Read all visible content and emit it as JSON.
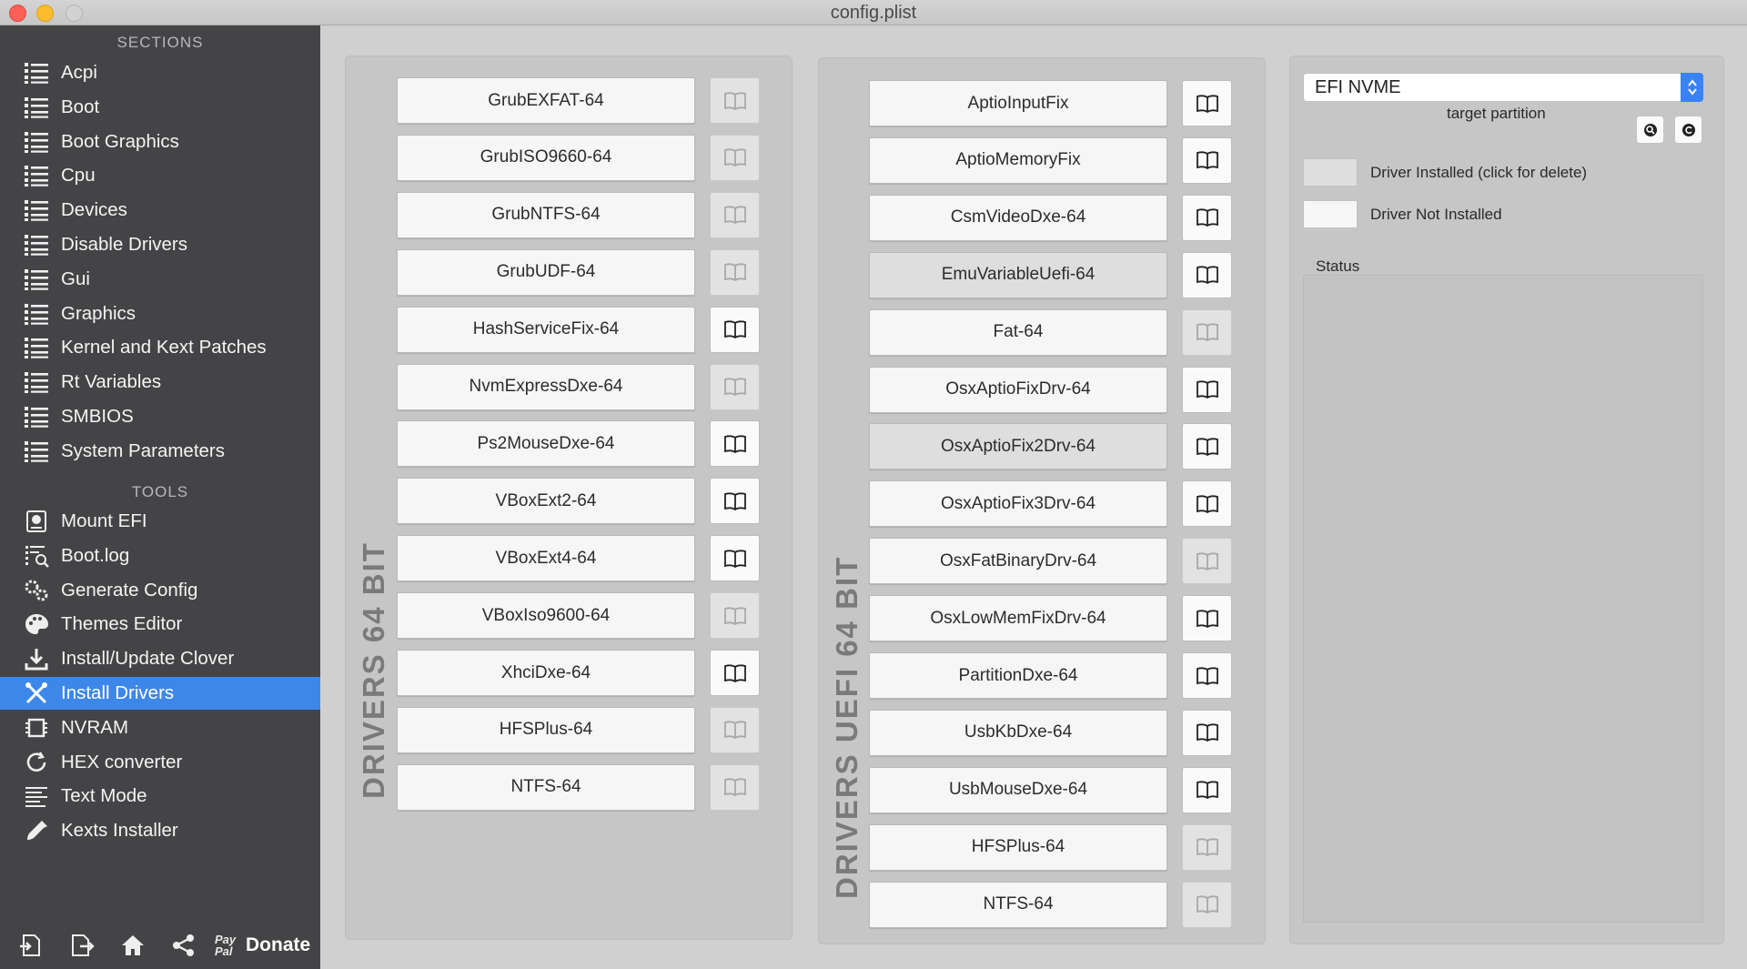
{
  "window": {
    "title": "config.plist"
  },
  "sidebar": {
    "sections_header": "SECTIONS",
    "sections": [
      {
        "label": "Acpi",
        "icon": "list-icon"
      },
      {
        "label": "Boot",
        "icon": "list-icon"
      },
      {
        "label": "Boot Graphics",
        "icon": "list-icon"
      },
      {
        "label": "Cpu",
        "icon": "list-icon"
      },
      {
        "label": "Devices",
        "icon": "list-icon"
      },
      {
        "label": "Disable Drivers",
        "icon": "list-icon"
      },
      {
        "label": "Gui",
        "icon": "list-icon"
      },
      {
        "label": "Graphics",
        "icon": "list-icon"
      },
      {
        "label": "Kernel and Kext Patches",
        "icon": "list-icon"
      },
      {
        "label": "Rt Variables",
        "icon": "list-icon"
      },
      {
        "label": "SMBIOS",
        "icon": "list-icon"
      },
      {
        "label": "System Parameters",
        "icon": "list-icon"
      }
    ],
    "tools_header": "TOOLS",
    "tools": [
      {
        "label": "Mount EFI",
        "icon": "disk-icon"
      },
      {
        "label": "Boot.log",
        "icon": "log-icon"
      },
      {
        "label": "Generate Config",
        "icon": "gears-icon"
      },
      {
        "label": "Themes Editor",
        "icon": "palette-icon"
      },
      {
        "label": "Install/Update Clover",
        "icon": "download-icon"
      },
      {
        "label": "Install Drivers",
        "icon": "tools-icon",
        "active": true
      },
      {
        "label": "NVRAM",
        "icon": "chip-icon"
      },
      {
        "label": "HEX converter",
        "icon": "refresh-icon"
      },
      {
        "label": "Text Mode",
        "icon": "text-icon"
      },
      {
        "label": "Kexts Installer",
        "icon": "dropper-icon"
      }
    ],
    "bottom": {
      "donate_label": "Donate",
      "paypal_mark": "Pay Pal"
    }
  },
  "drivers64": {
    "label": "DRIVERS 64 BIT",
    "items": [
      {
        "name": "GrubEXFAT-64",
        "installed": false,
        "info": false
      },
      {
        "name": "GrubISO9660-64",
        "installed": false,
        "info": false
      },
      {
        "name": "GrubNTFS-64",
        "installed": false,
        "info": false
      },
      {
        "name": "GrubUDF-64",
        "installed": false,
        "info": false
      },
      {
        "name": "HashServiceFix-64",
        "installed": false,
        "info": true
      },
      {
        "name": "NvmExpressDxe-64",
        "installed": false,
        "info": false
      },
      {
        "name": "Ps2MouseDxe-64",
        "installed": false,
        "info": true
      },
      {
        "name": "VBoxExt2-64",
        "installed": false,
        "info": true
      },
      {
        "name": "VBoxExt4-64",
        "installed": false,
        "info": true
      },
      {
        "name": "VBoxIso9600-64",
        "installed": false,
        "info": false
      },
      {
        "name": "XhciDxe-64",
        "installed": false,
        "info": true
      },
      {
        "name": "HFSPlus-64",
        "installed": false,
        "info": false
      },
      {
        "name": "NTFS-64",
        "installed": false,
        "info": false
      }
    ]
  },
  "driversUefi": {
    "label": "DRIVERS UEFI 64 BIT",
    "items": [
      {
        "name": "AptioInputFix",
        "installed": false,
        "info": true
      },
      {
        "name": "AptioMemoryFix",
        "installed": false,
        "info": true
      },
      {
        "name": "CsmVideoDxe-64",
        "installed": false,
        "info": true
      },
      {
        "name": "EmuVariableUefi-64",
        "installed": true,
        "info": true
      },
      {
        "name": "Fat-64",
        "installed": false,
        "info": false
      },
      {
        "name": "OsxAptioFixDrv-64",
        "installed": false,
        "info": true
      },
      {
        "name": "OsxAptioFix2Drv-64",
        "installed": true,
        "info": true
      },
      {
        "name": "OsxAptioFix3Drv-64",
        "installed": false,
        "info": true
      },
      {
        "name": "OsxFatBinaryDrv-64",
        "installed": false,
        "info": false
      },
      {
        "name": "OsxLowMemFixDrv-64",
        "installed": false,
        "info": true
      },
      {
        "name": "PartitionDxe-64",
        "installed": false,
        "info": true
      },
      {
        "name": "UsbKbDxe-64",
        "installed": false,
        "info": true
      },
      {
        "name": "UsbMouseDxe-64",
        "installed": false,
        "info": true
      },
      {
        "name": "HFSPlus-64",
        "installed": false,
        "info": false
      },
      {
        "name": "NTFS-64",
        "installed": false,
        "info": false
      }
    ]
  },
  "right": {
    "partition_value": "EFI NVME",
    "partition_caption": "target partition",
    "legend_installed": "Driver Installed (click for delete)",
    "legend_not_installed": "Driver Not Installed",
    "status_label": "Status"
  },
  "colors": {
    "accent": "#3d87e8",
    "sidebar_bg": "#444447",
    "installed_fill": "#dedede",
    "not_installed_fill": "#f6f6f6"
  }
}
